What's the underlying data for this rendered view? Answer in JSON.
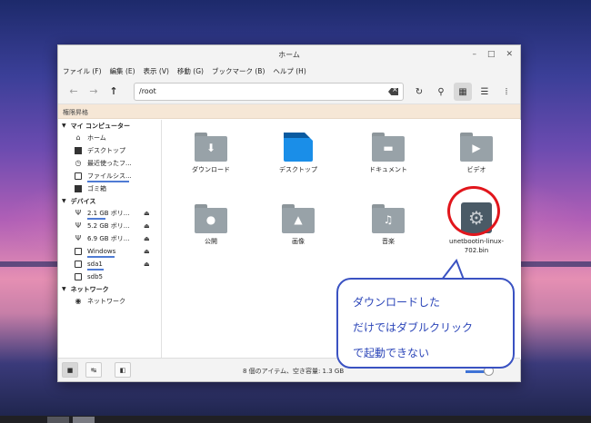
{
  "window": {
    "title": "ホーム",
    "menu": [
      "ファイル (F)",
      "編集 (E)",
      "表示 (V)",
      "移動 (G)",
      "ブックマーク (B)",
      "ヘルプ (H)"
    ],
    "path": "/root",
    "banner": "権限昇格"
  },
  "sidebar": {
    "my_computer": {
      "label": "マイ コンピューター",
      "items": [
        {
          "label": "ホーム",
          "icon": "home-icon"
        },
        {
          "label": "デスクトップ",
          "icon": "desktop-icon"
        },
        {
          "label": "最近使ったフ...",
          "icon": "recent-icon"
        },
        {
          "label": "ファイルシス...",
          "icon": "drive-icon"
        },
        {
          "label": "ゴミ箱",
          "icon": "trash-icon"
        }
      ]
    },
    "devices": {
      "label": "デバイス",
      "items": [
        {
          "label": "2.1 GB ボリ...",
          "icon": "usb-icon",
          "eject": true
        },
        {
          "label": "5.2 GB ボリ...",
          "icon": "usb-icon",
          "eject": true
        },
        {
          "label": "6.9 GB ボリ...",
          "icon": "usb-icon",
          "eject": true
        },
        {
          "label": "Windows",
          "icon": "drive-icon",
          "eject": true
        },
        {
          "label": "sda1",
          "icon": "drive-icon",
          "eject": true
        },
        {
          "label": "sdb5",
          "icon": "drive-icon",
          "eject": false
        }
      ]
    },
    "network": {
      "label": "ネットワーク",
      "items": [
        {
          "label": "ネットワーク",
          "icon": "network-icon"
        }
      ]
    }
  },
  "files": [
    {
      "label": "ダウンロード",
      "icon": "download-folder-icon",
      "glyph": "⬇"
    },
    {
      "label": "デスクトップ",
      "icon": "desktop-file-icon",
      "glyph": ""
    },
    {
      "label": "ドキュメント",
      "icon": "documents-folder-icon",
      "glyph": "▬"
    },
    {
      "label": "ビデオ",
      "icon": "video-folder-icon",
      "glyph": "▶"
    },
    {
      "label": "公開",
      "icon": "public-folder-icon",
      "glyph": "●"
    },
    {
      "label": "画像",
      "icon": "pictures-folder-icon",
      "glyph": "▲"
    },
    {
      "label": "音楽",
      "icon": "music-folder-icon",
      "glyph": "♫"
    },
    {
      "label": "unetbootin-linux-702.bin",
      "label_lines": [
        "unetbootin-linux-",
        "702.bin"
      ],
      "icon": "executable-gear-icon",
      "glyph": "⚙"
    }
  ],
  "status": {
    "text": "8 個のアイテム、空き容量: 1.3 GB"
  },
  "callout": {
    "lines": [
      "ダウンロードした",
      "だけではダブルクリック",
      "で起動できない"
    ]
  },
  "colors": {
    "callout_border": "#3a52c2",
    "highlight_circle": "#e1161c",
    "desktop_icon": "#1a8ee8"
  }
}
